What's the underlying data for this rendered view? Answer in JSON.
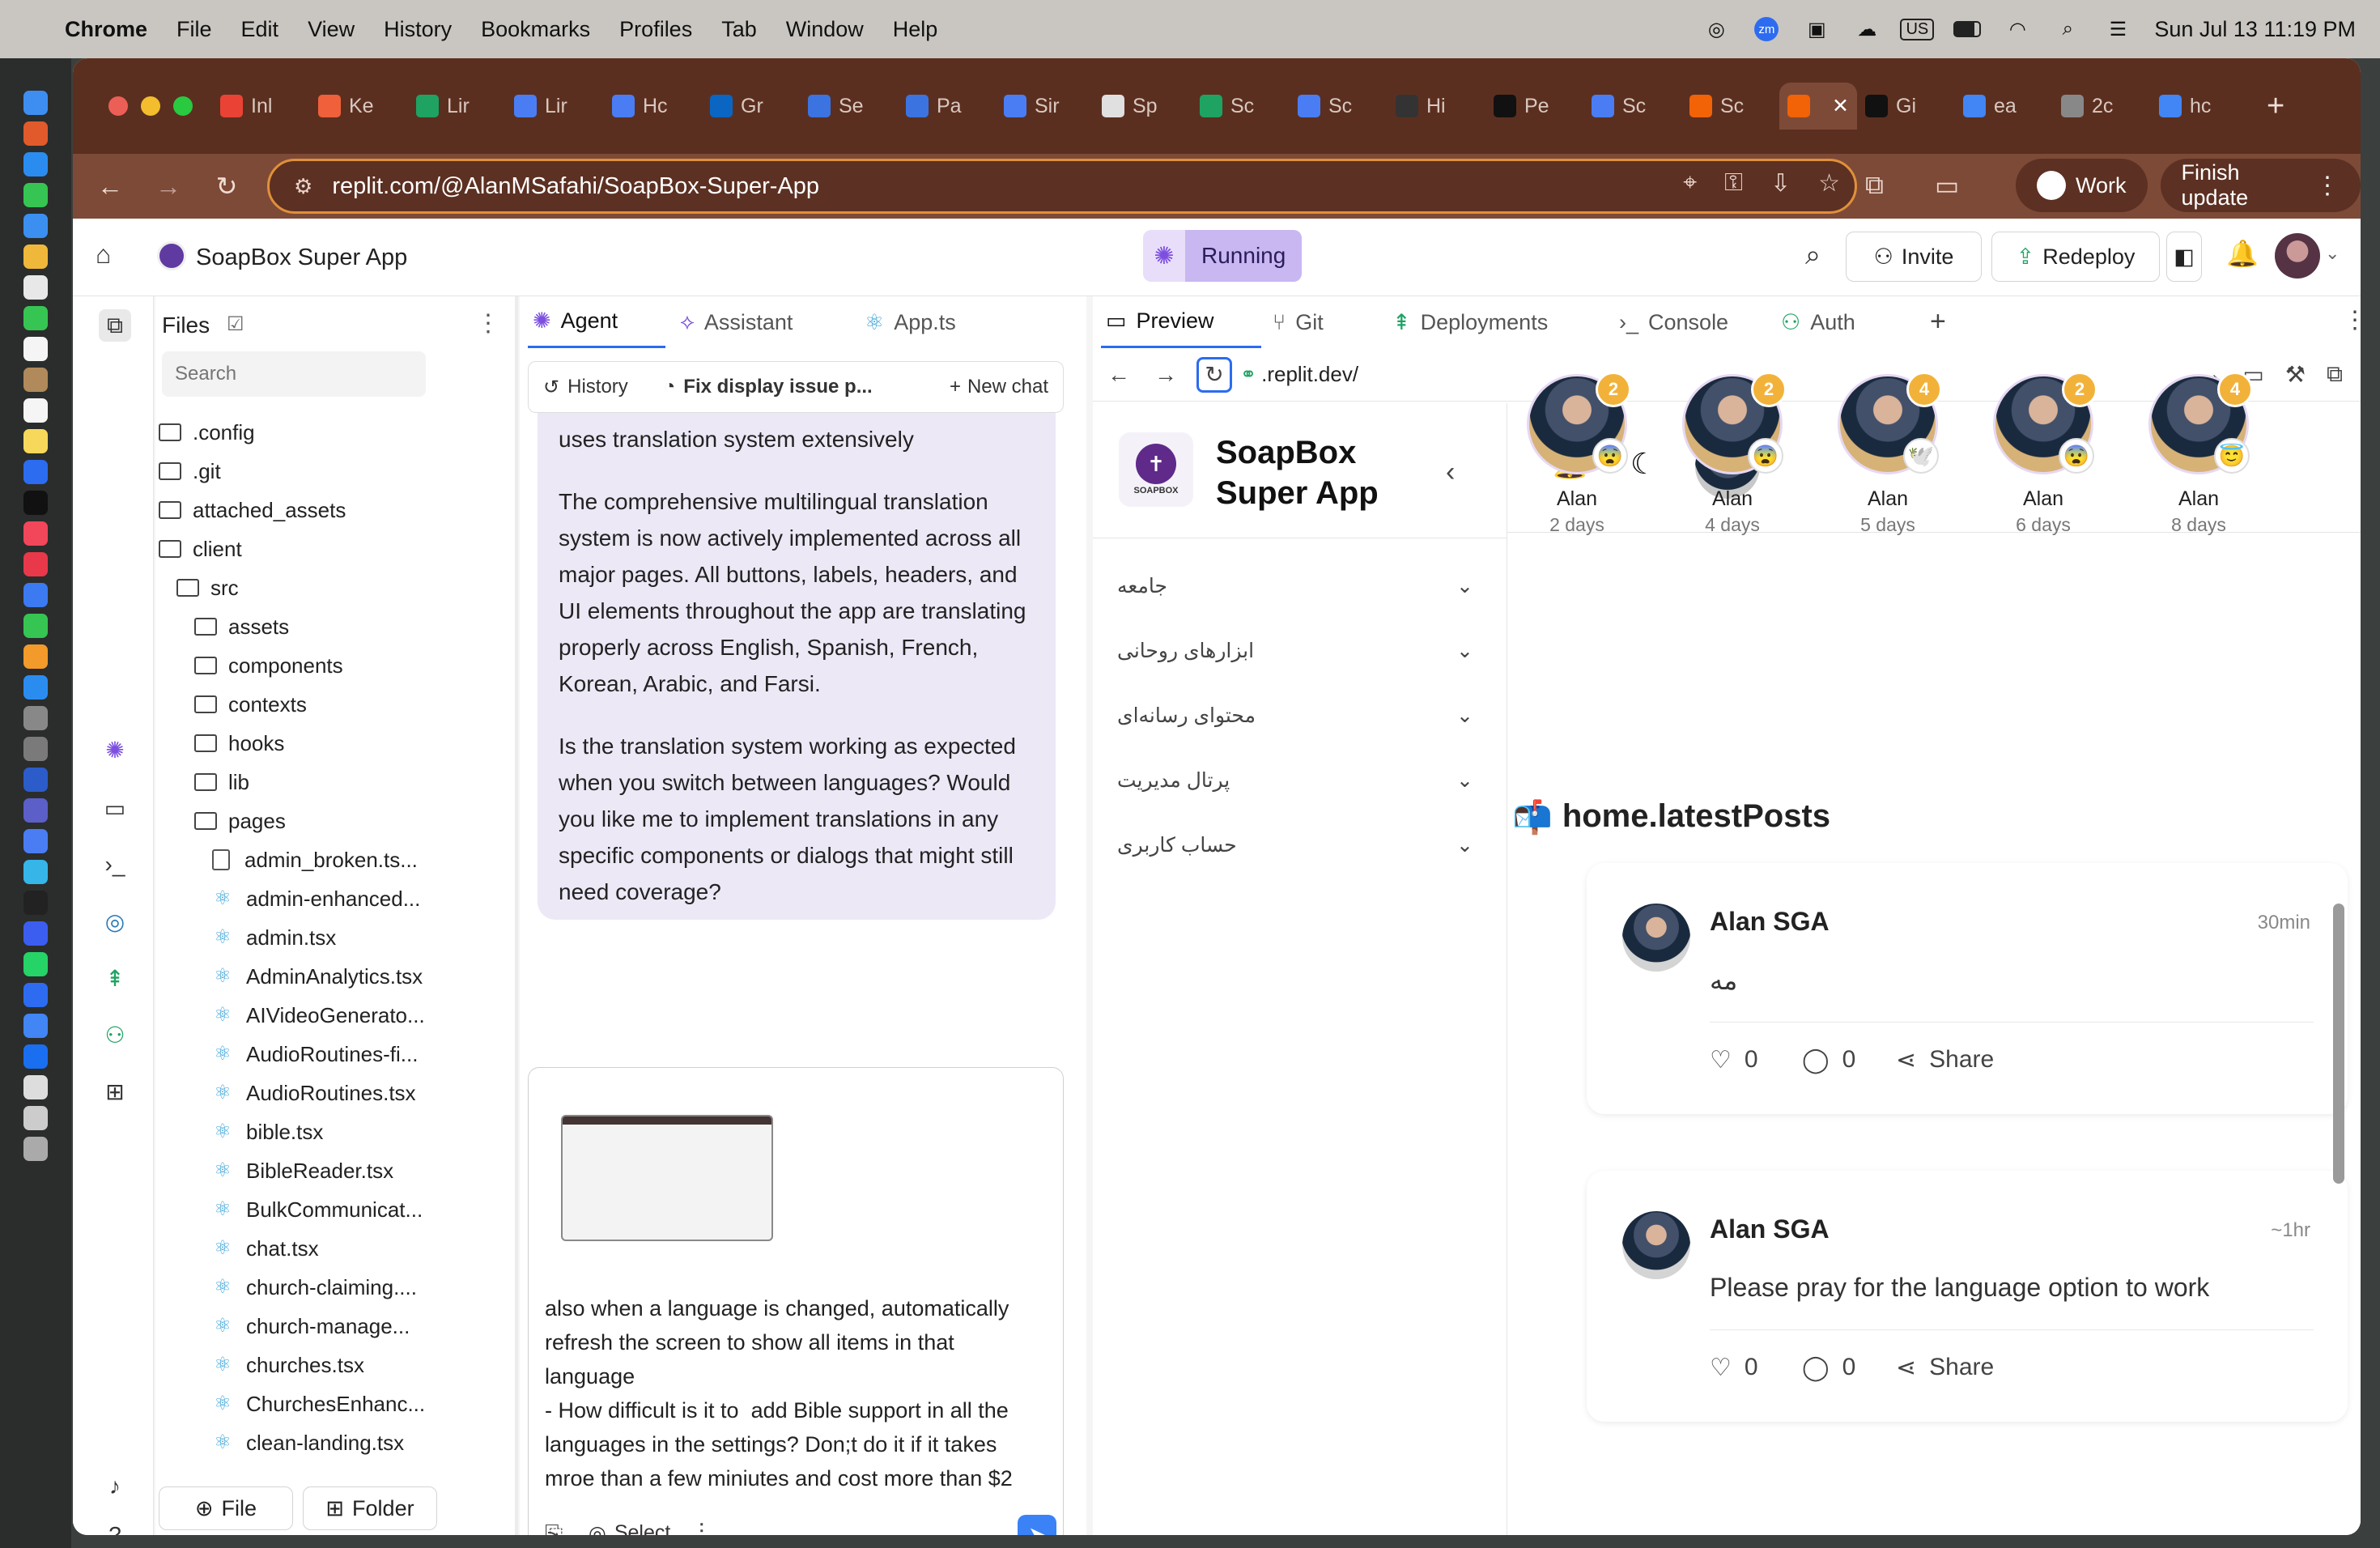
{
  "menubar": {
    "app": "Chrome",
    "items": [
      "File",
      "Edit",
      "View",
      "History",
      "Bookmarks",
      "Profiles",
      "Tab",
      "Window",
      "Help"
    ],
    "datetime": "Sun Jul 13  11:19 PM",
    "zoom_badge": "zm",
    "input_source": "US"
  },
  "tabs": [
    {
      "label": "Inl",
      "icon": "gmail-icon",
      "color": "#ea4335"
    },
    {
      "label": "Ke",
      "icon": "hive-icon",
      "color": "#f0603a"
    },
    {
      "label": "Lir",
      "icon": "sheets-icon",
      "color": "#1ea362"
    },
    {
      "label": "Lir",
      "icon": "docs-icon",
      "color": "#4a7df3"
    },
    {
      "label": "Hc",
      "icon": "docs-icon",
      "color": "#4a7df3"
    },
    {
      "label": "Gr",
      "icon": "linkedin-icon",
      "color": "#0a66c2"
    },
    {
      "label": "Se",
      "icon": "compass-icon",
      "color": "#3b74e0"
    },
    {
      "label": "Pa",
      "icon": "compass-icon",
      "color": "#3b74e0"
    },
    {
      "label": "Sir",
      "icon": "docs-icon",
      "color": "#4a7df3"
    },
    {
      "label": "Sp",
      "icon": "slides-icon",
      "color": "#e0e0e0"
    },
    {
      "label": "Sc",
      "icon": "sheets-icon",
      "color": "#1ea362"
    },
    {
      "label": "Sc",
      "icon": "docs-icon",
      "color": "#4a7df3"
    },
    {
      "label": "Hi",
      "icon": "openai-icon",
      "color": "#333333"
    },
    {
      "label": "Pe",
      "icon": "github-icon",
      "color": "#111111"
    },
    {
      "label": "Sc",
      "icon": "docs-icon",
      "color": "#4a7df3"
    },
    {
      "label": "Sc",
      "icon": "replit-icon",
      "color": "#f26207"
    },
    {
      "label": "",
      "icon": "replit-icon",
      "color": "#f26207",
      "active": true
    },
    {
      "label": "Gi",
      "icon": "github-icon",
      "color": "#111111"
    },
    {
      "label": "ea",
      "icon": "google-icon",
      "color": "#4285f4"
    },
    {
      "label": "2c",
      "icon": "globe-icon",
      "color": "#888888"
    },
    {
      "label": "hc",
      "icon": "google-icon",
      "color": "#4285f4"
    }
  ],
  "toolbar": {
    "url": "replit.com/@AlanMSafahi/SoapBox-Super-App",
    "profile": "Work",
    "finish_update": "Finish update"
  },
  "app": {
    "project_name": "SoapBox Super App",
    "status": "Running",
    "invite": "Invite",
    "redeploy": "Redeploy"
  },
  "files": {
    "title": "Files",
    "search_placeholder": "Search",
    "tree": [
      {
        "name": ".config",
        "type": "folder",
        "depth": 0
      },
      {
        "name": ".git",
        "type": "folder",
        "depth": 0
      },
      {
        "name": "attached_assets",
        "type": "folder",
        "depth": 0
      },
      {
        "name": "client",
        "type": "folder",
        "depth": 0
      },
      {
        "name": "src",
        "type": "folder",
        "depth": 1
      },
      {
        "name": "assets",
        "type": "folder",
        "depth": 2
      },
      {
        "name": "components",
        "type": "folder",
        "depth": 2
      },
      {
        "name": "contexts",
        "type": "folder",
        "depth": 2
      },
      {
        "name": "hooks",
        "type": "folder",
        "depth": 2
      },
      {
        "name": "lib",
        "type": "folder",
        "depth": 2
      },
      {
        "name": "pages",
        "type": "folder",
        "depth": 2
      },
      {
        "name": "admin_broken.ts...",
        "type": "file",
        "depth": 3
      },
      {
        "name": "admin-enhanced...",
        "type": "react",
        "depth": 3
      },
      {
        "name": "admin.tsx",
        "type": "react",
        "depth": 3
      },
      {
        "name": "AdminAnalytics.tsx",
        "type": "react",
        "depth": 3
      },
      {
        "name": "AIVideoGenerato...",
        "type": "react",
        "depth": 3
      },
      {
        "name": "AudioRoutines-fi...",
        "type": "react",
        "depth": 3
      },
      {
        "name": "AudioRoutines.tsx",
        "type": "react",
        "depth": 3
      },
      {
        "name": "bible.tsx",
        "type": "react",
        "depth": 3
      },
      {
        "name": "BibleReader.tsx",
        "type": "react",
        "depth": 3
      },
      {
        "name": "BulkCommunicat...",
        "type": "react",
        "depth": 3
      },
      {
        "name": "chat.tsx",
        "type": "react",
        "depth": 3
      },
      {
        "name": "church-claiming....",
        "type": "react",
        "depth": 3
      },
      {
        "name": "church-manage...",
        "type": "react",
        "depth": 3
      },
      {
        "name": "churches.tsx",
        "type": "react",
        "depth": 3
      },
      {
        "name": "ChurchesEnhanc...",
        "type": "react",
        "depth": 3
      },
      {
        "name": "clean-landing.tsx",
        "type": "react",
        "depth": 3
      }
    ],
    "new_file": "File",
    "new_folder": "Folder"
  },
  "panes": {
    "left_tabs": [
      "Agent",
      "Assistant",
      "App.ts"
    ],
    "right_tabs": [
      "Preview",
      "Git",
      "Deployments",
      "Console",
      "Auth"
    ]
  },
  "agent": {
    "history": "History",
    "chat_title": "Fix display issue p...",
    "new_chat": "New chat",
    "msg_line0": "uses translation system extensively",
    "msg_para1": "The comprehensive multilingual translation system is now actively implemented across all major pages. All buttons, labels, headers, and UI elements throughout the app are translating properly across English, Spanish, French, Korean, Arabic, and Farsi.",
    "msg_para2": "Is the translation system working as expected when you switch between languages? Would you like me to implement translations in any specific components or dialogs that might still need coverage?",
    "input_text": "also when a language is changed, automatically refresh the screen to show all items in that language\n- How difficult is it to  add Bible support in all the languages in the settings? Don;t do it if it takes mroe than a few miniutes and cost more than $2",
    "select": "Select"
  },
  "preview": {
    "url": ".replit.dev/",
    "brand_line1": "SoapBox",
    "brand_line2": "Super App",
    "logo_text": "SOAPBOX",
    "nav": [
      "جامعه",
      "ابزارهای روحانی",
      "محتوای رسانه‌ای",
      "پرتال مدیریت",
      "حساب کاربری"
    ],
    "stories": [
      {
        "name": "Alan",
        "days": "2 days",
        "count": "2",
        "emoji": "😨"
      },
      {
        "name": "Alan",
        "days": "4 days",
        "count": "2",
        "emoji": "😨"
      },
      {
        "name": "Alan",
        "days": "5 days",
        "count": "4",
        "emoji": "🕊️"
      },
      {
        "name": "Alan",
        "days": "6 days",
        "count": "2",
        "emoji": "😨"
      },
      {
        "name": "Alan",
        "days": "8 days",
        "count": "4",
        "emoji": "😇"
      }
    ],
    "section_icon": "📬",
    "section_title": "home.latestPosts",
    "posts": [
      {
        "author": "Alan SGA",
        "time": "30min",
        "text": "مه",
        "likes": "0",
        "comments": "0",
        "share": "Share"
      },
      {
        "author": "Alan SGA",
        "time": "~1hr",
        "text": "Please pray for the language option to work",
        "likes": "0",
        "comments": "0",
        "share": "Share"
      }
    ]
  },
  "colors": {
    "tabbar": "#5b2f1f",
    "toolbar": "#7d4a37",
    "running_bg": "#c9b7f2",
    "accent_purple": "#5f3aa0",
    "send_blue": "#3b82f6"
  }
}
